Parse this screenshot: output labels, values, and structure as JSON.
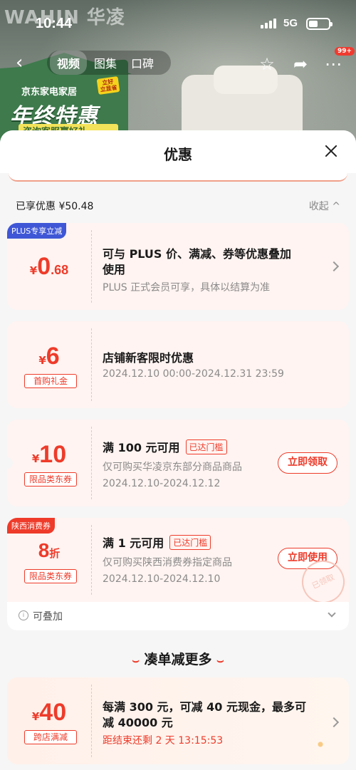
{
  "status_bar": {
    "time": "10:44",
    "network": "5G"
  },
  "header": {
    "brand": "WAHIN 华凌",
    "tabs": [
      "视频",
      "图集",
      "口碑"
    ],
    "active_tab": 0,
    "badge": "99+",
    "promo_small": "京东家电家居",
    "promo_big": "年终特惠",
    "promo_tag": "立好 立显省",
    "promo_sub": "咨询客服赢好礼"
  },
  "sheet": {
    "title": "优惠",
    "enjoyed": "已享优惠 ¥50.48",
    "collapse": "收起 ^"
  },
  "coupons": [
    {
      "corner": "PLUS专享立减",
      "yen": "¥",
      "num": "0",
      "dec": ".68",
      "title": "可与 PLUS 价、满减、券等优惠叠加",
      "title2": "使用",
      "sub": "PLUS 正式会员可享，具体以结算为准"
    },
    {
      "yen": "¥",
      "num": "6",
      "chip": "首购礼金",
      "title": "店铺新客限时优惠",
      "sub": "2024.12.10 00:00-2024.12.31 23:59"
    },
    {
      "yen": "¥",
      "num": "10",
      "chip": "限品类东券",
      "title": "满 100 元可用",
      "reached": "已达门槛",
      "sub": "仅可购买华凌京东部分商品商品",
      "sub2": "2024.12.10-2024.12.12",
      "button": "立即领取"
    },
    {
      "corner": "陕西消费券",
      "num": "8",
      "unit": "折",
      "chip": "限品类东券",
      "title": "满 1 元可用",
      "reached": "已达门槛",
      "sub": "仅可购买陕西消费券指定商品",
      "sub2": "2024.12.10-2024.12.10",
      "button": "立即使用",
      "stamp": "已领取"
    }
  ],
  "stackable": "可叠加",
  "more": {
    "title": "凑单减更多"
  },
  "promo_card": {
    "yen": "¥",
    "num": "40",
    "chip": "跨店满减",
    "title": "每满 300 元，可减 40 元现金，最多可",
    "title2": "减 40000 元",
    "countdown": "距结束还剩 2 天 13:15:53"
  }
}
